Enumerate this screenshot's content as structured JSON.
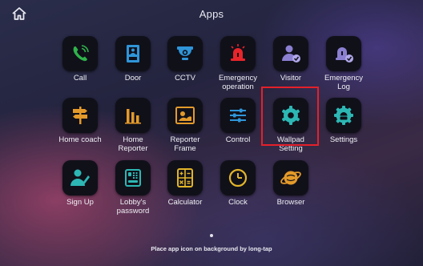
{
  "header": {
    "title": "Apps",
    "home_icon": "home-icon"
  },
  "apps": [
    {
      "id": "call",
      "label": "Call",
      "icon": "phone-icon"
    },
    {
      "id": "door",
      "label": "Door",
      "icon": "door-intercom-icon"
    },
    {
      "id": "cctv",
      "label": "CCTV",
      "icon": "cctv-camera-icon"
    },
    {
      "id": "emergency-operation",
      "label": "Emergency\noperation",
      "icon": "siren-icon"
    },
    {
      "id": "visitor",
      "label": "Visitor",
      "icon": "visitor-icon"
    },
    {
      "id": "emergency-log",
      "label": "Emergency\nLog",
      "icon": "siren-log-icon"
    },
    {
      "id": "home-coach",
      "label": "Home coach",
      "icon": "signpost-icon"
    },
    {
      "id": "home-reporter",
      "label": "Home\nReporter",
      "icon": "bar-chart-icon"
    },
    {
      "id": "reporter-frame",
      "label": "Reporter\nFrame",
      "icon": "picture-frame-icon"
    },
    {
      "id": "control",
      "label": "Control",
      "icon": "sliders-icon"
    },
    {
      "id": "wallpad-setting",
      "label": "Wallpad\nSetting",
      "icon": "gear-icon"
    },
    {
      "id": "settings",
      "label": "Settings",
      "icon": "android-gear-icon"
    },
    {
      "id": "sign-up",
      "label": "Sign Up",
      "icon": "user-sign-icon"
    },
    {
      "id": "lobbys-password",
      "label": "Lobby's\npassword",
      "icon": "keypad-lock-icon"
    },
    {
      "id": "calculator",
      "label": "Calculator",
      "icon": "calculator-icon"
    },
    {
      "id": "clock",
      "label": "Clock",
      "icon": "clock-icon"
    },
    {
      "id": "browser",
      "label": "Browser",
      "icon": "globe-icon"
    }
  ],
  "highlighted_app": "wallpad-setting",
  "page_indicator": {
    "current": 1,
    "total": 1
  },
  "footer": {
    "hint": "Place app icon on background by long-tap"
  },
  "colors": {
    "green": "#2fb34a",
    "blue": "#2f95d8",
    "red": "#e8252b",
    "purple": "#8a7fd0",
    "teal": "#2db7b4",
    "orange": "#e39a2a",
    "yellow": "#e2b52a",
    "highlight": "#e5202a"
  }
}
